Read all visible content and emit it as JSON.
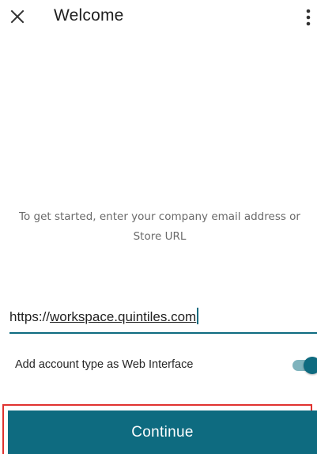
{
  "app_bar": {
    "title": "Welcome",
    "close_icon": "close-icon",
    "more_icon": "more-vertical-icon"
  },
  "instructions": {
    "line1": "To get started, enter your company email address or",
    "line2": "Store URL"
  },
  "url_field": {
    "value_prefix": "https://",
    "value_host": "workspace.quintiles.com"
  },
  "toggle_row": {
    "label": "Add account type as Web Interface",
    "checked": true
  },
  "continue_button": {
    "label": "Continue"
  },
  "colors": {
    "accent": "#0e6b80",
    "highlight_outline": "#e0322f"
  }
}
